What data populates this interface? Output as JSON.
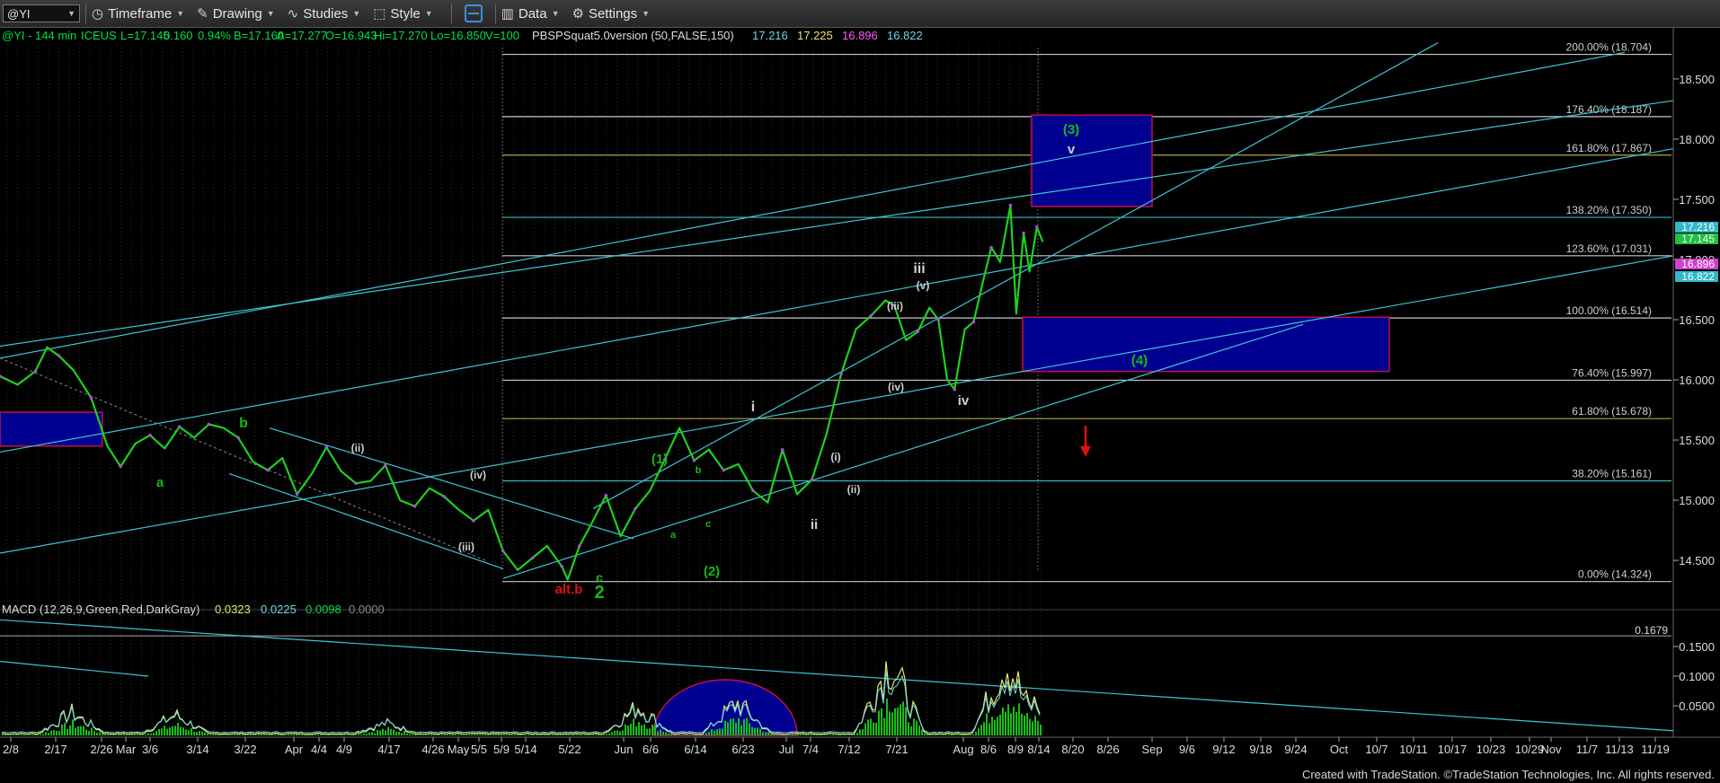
{
  "toolbar": {
    "symbol": "@YI",
    "items": [
      {
        "label": "Timeframe",
        "icon": "clock-icon"
      },
      {
        "label": "Drawing",
        "icon": "pencil-icon"
      },
      {
        "label": "Studies",
        "icon": "studies-icon"
      },
      {
        "label": "Style",
        "icon": "style-icon"
      },
      {
        "label": "Data",
        "icon": "data-icon"
      },
      {
        "label": "Settings",
        "icon": "gear-icon"
      }
    ]
  },
  "header": {
    "segments": [
      {
        "text": "@YI - 144 min",
        "color": "#00e04a"
      },
      {
        "text": "ICEUS",
        "color": "#00e04a"
      },
      {
        "text": "L=17.145",
        "color": "#00e04a"
      },
      {
        "text": "0.160",
        "color": "#00e04a"
      },
      {
        "text": "0.94%",
        "color": "#00e04a"
      },
      {
        "text": "B=17.160",
        "color": "#00e04a"
      },
      {
        "text": "A=17.277",
        "color": "#00e04a"
      },
      {
        "text": "O=16.943",
        "color": "#00e04a"
      },
      {
        "text": "Hi=17.270",
        "color": "#00e04a"
      },
      {
        "text": "Lo=16.850",
        "color": "#00e04a"
      },
      {
        "text": "V=100",
        "color": "#00e04a"
      },
      {
        "text": "PBSPSquat5.0version (50,FALSE,150)",
        "color": "#dddddd"
      },
      {
        "text": "17.216",
        "color": "#6ed8e6"
      },
      {
        "text": "17.225",
        "color": "#e6e66e"
      },
      {
        "text": "16.896",
        "color": "#ff5cff"
      },
      {
        "text": "16.822",
        "color": "#6ed8e6"
      }
    ]
  },
  "macd_header": {
    "segments": [
      {
        "text": "MACD (12,26,9,Green,Red,DarkGray)",
        "color": "#dddddd"
      },
      {
        "text": "0.0323",
        "color": "#e6e66e"
      },
      {
        "text": "0.0225",
        "color": "#6ed8e6"
      },
      {
        "text": "0.0098",
        "color": "#00e04a"
      },
      {
        "text": "0.0000",
        "color": "#888888"
      }
    ]
  },
  "chart_data": {
    "type": "line",
    "title": "@YI - 144 min",
    "y_axis": {
      "ticks": [
        "18.500",
        "18.000",
        "17.500",
        "17.000",
        "16.500",
        "16.000",
        "15.500",
        "15.000",
        "14.500"
      ],
      "range": [
        14.15,
        18.85
      ]
    },
    "x_axis": {
      "ticks": [
        "2/8",
        "2/17",
        "2/26",
        "Mar",
        "3/6",
        "3/14",
        "3/22",
        "Apr",
        "4/4",
        "4/9",
        "4/17",
        "4/26",
        "May",
        "5/5",
        "5/9",
        "5/14",
        "5/22",
        "Jun",
        "6/6",
        "6/14",
        "6/23",
        "Jul",
        "7/4",
        "7/12",
        "7/21",
        "Aug",
        "8/6",
        "8/9",
        "8/14",
        "8/20",
        "8/26",
        "Sep",
        "9/6",
        "9/12",
        "9/18",
        "9/24",
        "Oct",
        "10/7",
        "10/11",
        "10/17",
        "10/23",
        "10/29",
        "Nov",
        "11/7",
        "11/13",
        "11/19"
      ]
    },
    "price_tags": [
      {
        "value": "17.216",
        "color": "#2fb8c8"
      },
      {
        "value": "17.145",
        "color": "#20c040"
      },
      {
        "value": "16.896",
        "color": "#d040d0"
      },
      {
        "value": "16.822",
        "color": "#2fb8c8"
      }
    ],
    "fib_levels": [
      {
        "label": "200.00% (18.704)",
        "value": 18.704,
        "color": "#c8c8c8"
      },
      {
        "label": "176.40% (18.187)",
        "value": 18.187,
        "color": "#c8c8c8"
      },
      {
        "label": "161.80% (17.867)",
        "value": 17.867,
        "color": "#b5a24a"
      },
      {
        "label": "138.20% (17.350)",
        "value": 17.35,
        "color": "#3fb5c0"
      },
      {
        "label": "123.60% (17.031)",
        "value": 17.031,
        "color": "#c8c8c8"
      },
      {
        "label": "100.00% (16.514)",
        "value": 16.514,
        "color": "#c8c8c8"
      },
      {
        "label": "76.40% (15.997)",
        "value": 15.997,
        "color": "#c8c8c8"
      },
      {
        "label": "61.80% (15.678)",
        "value": 15.678,
        "color": "#b5a24a"
      },
      {
        "label": "38.20% (15.161)",
        "value": 15.161,
        "color": "#3fb5c0"
      },
      {
        "label": "0.00% (14.324)",
        "value": 14.324,
        "color": "#c8c8c8"
      }
    ],
    "price_series": [
      [
        0,
        16.03
      ],
      [
        1.2,
        15.96
      ],
      [
        2.4,
        16.07
      ],
      [
        3.2,
        16.27
      ],
      [
        4,
        16.2
      ],
      [
        5,
        16.08
      ],
      [
        6.2,
        15.85
      ],
      [
        7.3,
        15.45
      ],
      [
        8.2,
        15.28
      ],
      [
        9.2,
        15.47
      ],
      [
        10.2,
        15.54
      ],
      [
        11.2,
        15.43
      ],
      [
        12.2,
        15.61
      ],
      [
        13.2,
        15.52
      ],
      [
        14.2,
        15.63
      ],
      [
        15.2,
        15.6
      ],
      [
        16.2,
        15.52
      ],
      [
        17.2,
        15.32
      ],
      [
        18.2,
        15.25
      ],
      [
        19.2,
        15.35
      ],
      [
        20.2,
        15.05
      ],
      [
        21.2,
        15.22
      ],
      [
        22.2,
        15.44
      ],
      [
        23.2,
        15.24
      ],
      [
        24.2,
        15.14
      ],
      [
        25.2,
        15.16
      ],
      [
        26.2,
        15.29
      ],
      [
        27.2,
        15.0
      ],
      [
        28.2,
        14.95
      ],
      [
        29.2,
        15.1
      ],
      [
        30.2,
        15.03
      ],
      [
        31.2,
        14.92
      ],
      [
        32.2,
        14.83
      ],
      [
        33.2,
        14.92
      ],
      [
        34.2,
        14.58
      ],
      [
        35.2,
        14.42
      ],
      [
        36.2,
        14.52
      ],
      [
        37.2,
        14.62
      ],
      [
        38.2,
        14.45
      ],
      [
        38.6,
        14.34
      ],
      [
        39.4,
        14.62
      ],
      [
        40.2,
        14.8
      ],
      [
        41.2,
        15.04
      ],
      [
        42.2,
        14.7
      ],
      [
        43.2,
        14.93
      ],
      [
        44.2,
        15.08
      ],
      [
        45.2,
        15.34
      ],
      [
        46.2,
        15.6
      ],
      [
        47.2,
        15.33
      ],
      [
        48.2,
        15.42
      ],
      [
        49.2,
        15.25
      ],
      [
        50.2,
        15.3
      ],
      [
        51.2,
        15.08
      ],
      [
        52.2,
        14.98
      ],
      [
        53.2,
        15.42
      ],
      [
        54.2,
        15.05
      ],
      [
        55.2,
        15.17
      ],
      [
        56.2,
        15.55
      ],
      [
        57.2,
        16.05
      ],
      [
        58.2,
        16.42
      ],
      [
        59.2,
        16.53
      ],
      [
        60.2,
        16.66
      ],
      [
        60.8,
        16.62
      ],
      [
        61.6,
        16.33
      ],
      [
        62.4,
        16.4
      ],
      [
        63.2,
        16.6
      ],
      [
        63.8,
        16.5
      ],
      [
        64.4,
        16.0
      ],
      [
        64.9,
        15.92
      ],
      [
        65.6,
        16.42
      ],
      [
        66.2,
        16.48
      ],
      [
        66.8,
        16.8
      ],
      [
        67.4,
        17.1
      ],
      [
        68.0,
        16.98
      ],
      [
        68.7,
        17.45
      ],
      [
        69.1,
        16.55
      ],
      [
        69.6,
        17.22
      ],
      [
        70.0,
        16.9
      ],
      [
        70.5,
        17.27
      ],
      [
        70.9,
        17.145
      ]
    ],
    "series_x_range": [
      0,
      71
    ],
    "macd": {
      "level_label": "0.1679",
      "ticks": [
        "0.1500",
        "0.1000",
        "0.0500"
      ],
      "range": [
        0,
        0.2
      ]
    }
  },
  "labels": [
    {
      "text": "b",
      "color": "#16b816"
    },
    {
      "text": "a",
      "color": "#16b816"
    },
    {
      "text": "(ii)",
      "color": "#cfcfcf"
    },
    {
      "text": "(iv)",
      "color": "#cfcfcf"
    },
    {
      "text": "(iii)",
      "color": "#cfcfcf"
    },
    {
      "text": "alt.b",
      "color": "#e01010"
    },
    {
      "text": "c",
      "color": "#16b816"
    },
    {
      "text": "2",
      "color": "#16b816"
    },
    {
      "text": "(1)",
      "color": "#16b816"
    },
    {
      "text": "b",
      "color": "#16b816"
    },
    {
      "text": "a",
      "color": "#16b816"
    },
    {
      "text": "c",
      "color": "#16b816"
    },
    {
      "text": "(2)",
      "color": "#16b816"
    },
    {
      "text": "i",
      "color": "#cfcfcf"
    },
    {
      "text": "ii",
      "color": "#cfcfcf"
    },
    {
      "text": "(i)",
      "color": "#cfcfcf"
    },
    {
      "text": "(ii)",
      "color": "#cfcfcf"
    },
    {
      "text": "(iii)",
      "color": "#cfcfcf"
    },
    {
      "text": "(iv)",
      "color": "#cfcfcf"
    },
    {
      "text": "(v)",
      "color": "#cfcfcf"
    },
    {
      "text": "iii",
      "color": "#cfcfcf"
    },
    {
      "text": "iv",
      "color": "#cfcfcf"
    },
    {
      "text": "(3)",
      "color": "#16b816"
    },
    {
      "text": "v",
      "color": "#cfcfcf"
    },
    {
      "text": "(4)",
      "color": "#16b816"
    }
  ],
  "footer": "Created with TradeStation. ©TradeStation Technologies, Inc. All rights reserved."
}
